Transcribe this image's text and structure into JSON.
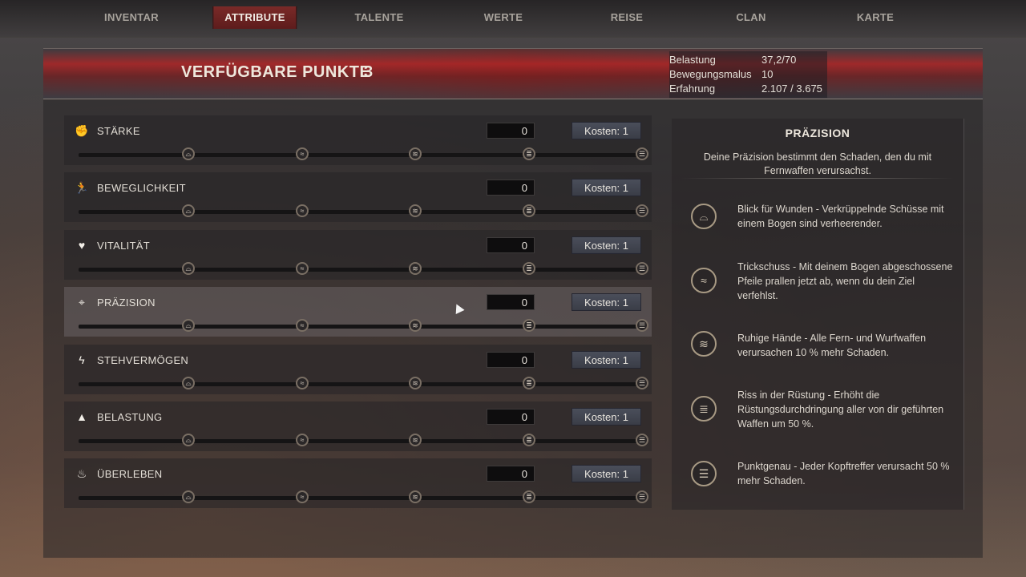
{
  "nav": {
    "tabs": [
      "INVENTAR",
      "ATTRIBUTE",
      "TALENTE",
      "WERTE",
      "REISE",
      "CLAN",
      "KARTE"
    ],
    "active_tab": "ATTRIBUTE"
  },
  "header": {
    "title": "VERFÜGBARE PUNKTE",
    "points": "3",
    "stats": [
      {
        "label": "Belastung",
        "value": "37,2/70"
      },
      {
        "label": "Bewegungsmalus",
        "value": "10"
      },
      {
        "label": "Erfahrung",
        "value": "2.107 / 3.675"
      }
    ]
  },
  "attributes": [
    {
      "name": "STÄRKE",
      "value": "0",
      "cost": "Kosten: 1",
      "icon": "fist-icon"
    },
    {
      "name": "BEWEGLICHKEIT",
      "value": "0",
      "cost": "Kosten: 1",
      "icon": "running-figure-icon"
    },
    {
      "name": "VITALITÄT",
      "value": "0",
      "cost": "Kosten: 1",
      "icon": "heart-icon"
    },
    {
      "name": "PRÄZISION",
      "value": "0",
      "cost": "Kosten: 1",
      "icon": "crosshair-icon",
      "selected": true
    },
    {
      "name": "STEHVERMÖGEN",
      "value": "0",
      "cost": "Kosten: 1",
      "icon": "lightning-icon"
    },
    {
      "name": "BELASTUNG",
      "value": "0",
      "cost": "Kosten: 1",
      "icon": "weight-icon"
    },
    {
      "name": "ÜBERLEBEN",
      "value": "0",
      "cost": "Kosten: 1",
      "icon": "campfire-icon"
    }
  ],
  "detail": {
    "title": "PRÄZISION",
    "description": "Deine Präzision bestimmt den Schaden, den du mit Fernwaffen verursachst.",
    "perks": [
      {
        "text": "Blick für Wunden - Verkrüppelnde Schüsse mit einem Bogen sind verheerender.",
        "icon": "perk-tier-1-icon"
      },
      {
        "text": "Trickschuss - Mit deinem Bogen abgeschossene Pfeile prallen jetzt ab, wenn du dein Ziel verfehlst.",
        "icon": "perk-tier-2-icon"
      },
      {
        "text": "Ruhige Hände - Alle Fern- und Wurfwaffen verursachen 10 % mehr Schaden.",
        "icon": "perk-tier-3-icon"
      },
      {
        "text": "Riss in der Rüstung - Erhöht die Rüstungsdurchdringung aller von dir geführten Waffen um 50 %.",
        "icon": "perk-tier-4-icon"
      },
      {
        "text": "Punktgenau - Jeder Kopftreffer verursacht 50 % mehr Schaden.",
        "icon": "perk-tier-5-icon"
      }
    ]
  }
}
